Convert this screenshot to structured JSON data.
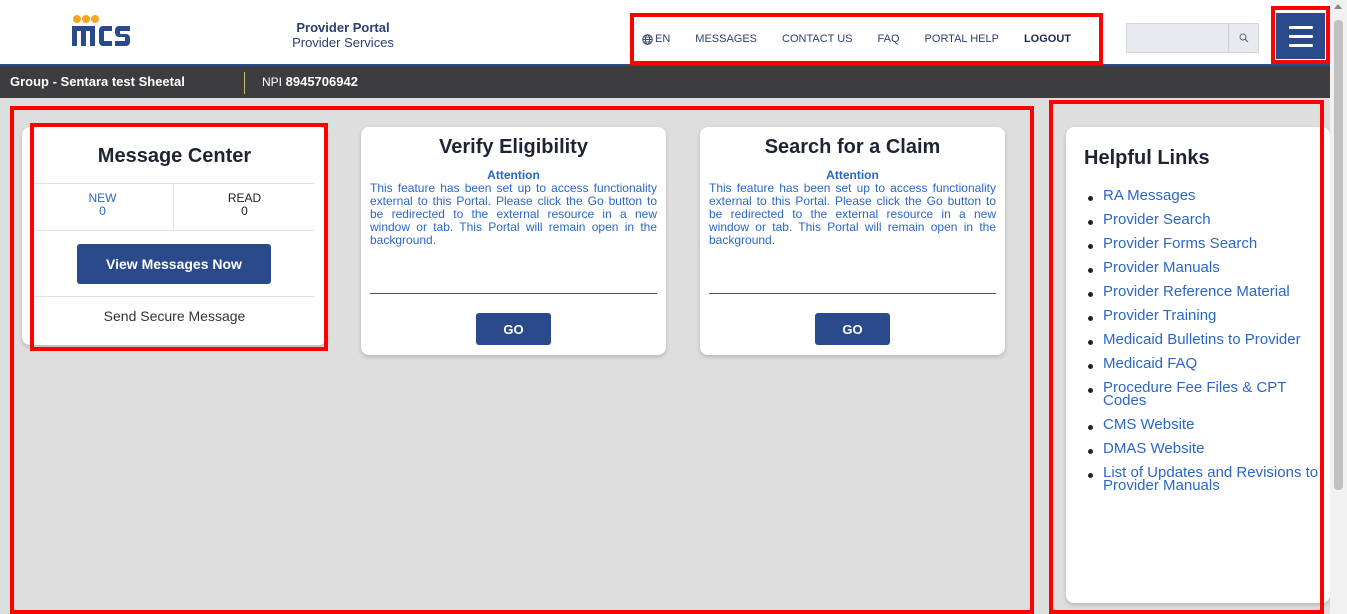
{
  "header": {
    "logo_text": "mcs",
    "portal_title": "Provider Portal",
    "portal_subtitle": "Provider Services",
    "nav": [
      {
        "label": "EN",
        "icon": "globe-icon"
      },
      {
        "label": "MESSAGES"
      },
      {
        "label": "CONTACT US"
      },
      {
        "label": "FAQ"
      },
      {
        "label": "PORTAL HELP"
      },
      {
        "label": "LOGOUT"
      }
    ],
    "search_placeholder": "",
    "search_icon": "search-icon",
    "menu_icon": "hamburger-menu-icon"
  },
  "groupbar": {
    "group": "Group - Sentara test Sheetal",
    "npi_label": "NPI",
    "npi_value": "8945706942"
  },
  "message_center": {
    "title": "Message Center",
    "new_label": "NEW",
    "new_count": "0",
    "read_label": "READ",
    "read_count": "0",
    "view_button": "View Messages Now",
    "send_link": "Send Secure Message"
  },
  "features": [
    {
      "title": "Verify Eligibility",
      "attention": "Attention",
      "description": "This feature has been set up to access functionality external to this Portal. Please click the Go button to be redirected to the external resource in a new window or tab. This Portal will remain open in the background.",
      "button": "GO"
    },
    {
      "title": "Search for a Claim",
      "attention": "Attention",
      "description": "This feature has been set up to access functionality external to this Portal. Please click the Go button to be redirected to the external resource in a new window or tab. This Portal will remain open in the background.",
      "button": "GO"
    }
  ],
  "helpful_links": {
    "title": "Helpful Links",
    "items": [
      "RA Messages",
      "Provider Search",
      "Provider Forms Search",
      "Provider Manuals",
      "Provider Reference Material",
      "Provider Training",
      "Medicaid Bulletins to Provider",
      "Medicaid FAQ",
      "Procedure Fee Files & CPT Codes",
      "CMS Website",
      "DMAS Website",
      "List of Updates and Revisions to Provider Manuals"
    ]
  },
  "colors": {
    "brand_blue": "#2b4a8c",
    "link_blue": "#2a67c9",
    "group_bar": "#3d3d3f",
    "annotation_red": "#ff0000"
  }
}
